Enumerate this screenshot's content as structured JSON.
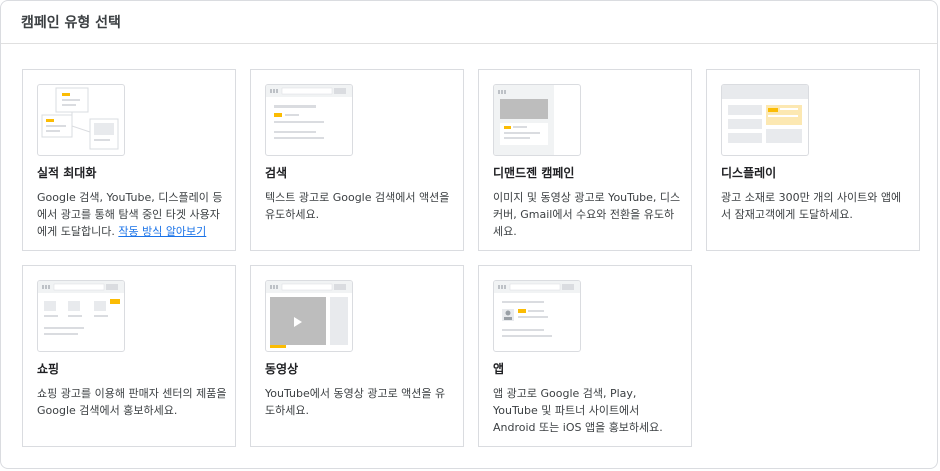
{
  "header": {
    "title": "캠페인 유형 선택"
  },
  "accent_color": "#fbbc04",
  "cards": [
    {
      "key": "performance-max",
      "icon": "performance-max-illustration",
      "title": "실적 최대화",
      "description": "Google 검색, YouTube, 디스플레이 등에서 광고를 통해 탐색 중인 타겟 사용자에게 도달합니다.",
      "link": "작동 방식 알아보기"
    },
    {
      "key": "search",
      "icon": "search-illustration",
      "title": "검색",
      "description": "텍스트 광고로 Google 검색에서 액션을 유도하세요."
    },
    {
      "key": "demand-gen",
      "icon": "demand-gen-illustration",
      "title": "디맨드젠 캠페인",
      "description": "이미지 및 동영상 광고로 YouTube, 디스커버, Gmail에서 수요와 전환을 유도하세요."
    },
    {
      "key": "display",
      "icon": "display-illustration",
      "title": "디스플레이",
      "description": "광고 소재로 300만 개의 사이트와 앱에서 잠재고객에게 도달하세요."
    },
    {
      "key": "shopping",
      "icon": "shopping-illustration",
      "title": "쇼핑",
      "description": "쇼핑 광고를 이용해 판매자 센터의 제품을 Google 검색에서 홍보하세요."
    },
    {
      "key": "video",
      "icon": "video-illustration",
      "title": "동영상",
      "description": "YouTube에서 동영상 광고로 액션을 유도하세요."
    },
    {
      "key": "app",
      "icon": "app-illustration",
      "title": "앱",
      "description": "앱 광고로 Google 검색, Play, YouTube 및 파트너 사이트에서 Android 또는 iOS 앱을 홍보하세요."
    }
  ]
}
